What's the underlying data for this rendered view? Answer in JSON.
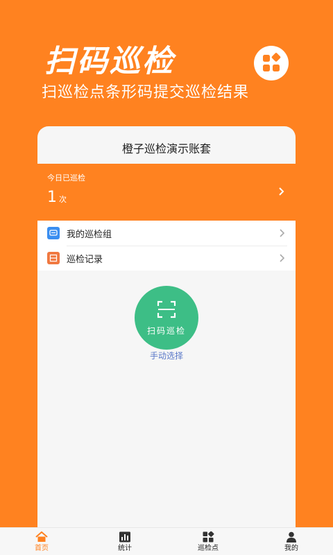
{
  "hero": {
    "title": "扫码巡检",
    "subtitle": "扫巡检点条形码提交巡检结果"
  },
  "account": {
    "name": "橙子巡检演示账套"
  },
  "stats": {
    "label": "今日已巡检",
    "count": "1",
    "unit": "次"
  },
  "menu": {
    "items": [
      {
        "label": "我的巡检组",
        "icon": "chat-icon"
      },
      {
        "label": "巡检记录",
        "icon": "list-icon"
      }
    ]
  },
  "scan": {
    "label": "扫码巡检",
    "manual": "手动选择"
  },
  "tabs": [
    {
      "label": "首页",
      "icon": "home-icon",
      "active": true
    },
    {
      "label": "统计",
      "icon": "chart-icon",
      "active": false
    },
    {
      "label": "巡检点",
      "icon": "grid-icon",
      "active": false
    },
    {
      "label": "我的",
      "icon": "user-icon",
      "active": false
    }
  ],
  "colors": {
    "brand": "#FF8220",
    "scan_green": "#3DBE86",
    "link_blue": "#5A78C8"
  }
}
